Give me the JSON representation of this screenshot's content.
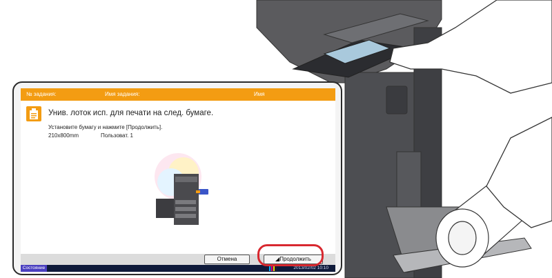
{
  "job_bar": {
    "job_number_label": "№ задания:",
    "job_name_label": "Имя задания:",
    "user_name_label": "Имя"
  },
  "message": {
    "icon": "paper-tray-icon",
    "title": "Унив. лоток исп. для печати на след. бумаге.",
    "instruction": "Установите бумагу и нажмите [Продолжить].",
    "paper_size": "210x800mm",
    "paper_type": "Пользоват. 1"
  },
  "buttons": {
    "cancel": "Отмена",
    "continue": "Продолжить"
  },
  "status_bar": {
    "tab_label": "Состояние",
    "datetime": "2013/02/02  10:10",
    "toner_colors": [
      "#00b0ff",
      "#e6007e",
      "#ffd400",
      "#222222"
    ]
  },
  "colors": {
    "accent_orange": "#f39c12",
    "highlight_red": "#d8282f",
    "status_blue": "#4a3fc0"
  }
}
